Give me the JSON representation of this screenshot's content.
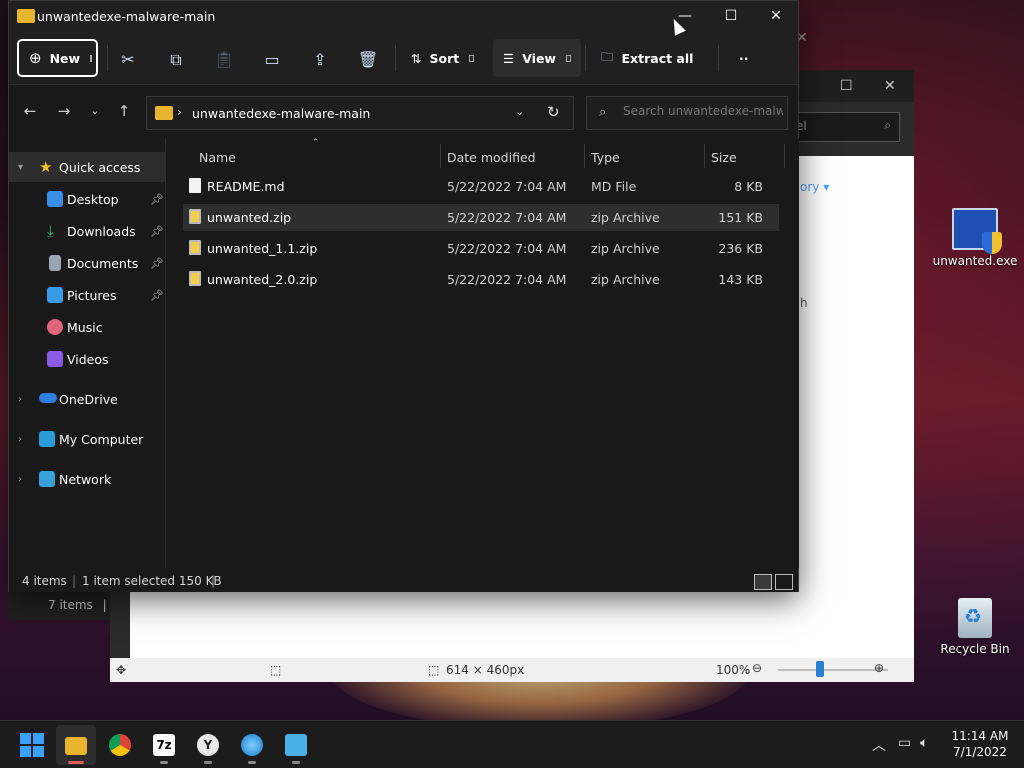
{
  "window": {
    "title": "unwantedexe-malware-main",
    "controls": {
      "minimize": "—",
      "maximize": "☐",
      "close": "✕"
    }
  },
  "toolbar": {
    "new_label": "New",
    "sort_label": "Sort",
    "view_label": "View",
    "extract_label": "Extract all",
    "more_label": "··"
  },
  "address": {
    "path": "unwantedexe-malware-main",
    "search_placeholder": "Search unwantedexe-malwa..."
  },
  "nav": {
    "quick_access": "Quick access",
    "items": [
      {
        "label": "Desktop",
        "icon": "desktop-icon",
        "color": "#3b8ee6",
        "pinned": true
      },
      {
        "label": "Downloads",
        "icon": "downloads-icon",
        "color": "#3fbf7a",
        "pinned": true
      },
      {
        "label": "Documents",
        "icon": "documents-icon",
        "color": "#9aa4b2",
        "pinned": true
      },
      {
        "label": "Pictures",
        "icon": "pictures-icon",
        "color": "#3b9ae6",
        "pinned": true
      },
      {
        "label": "Music",
        "icon": "music-icon",
        "color": "#e0647a",
        "pinned": false
      },
      {
        "label": "Videos",
        "icon": "videos-icon",
        "color": "#8a5ce6",
        "pinned": false
      }
    ],
    "onedrive": "OneDrive",
    "my_computer": "My Computer",
    "network": "Network"
  },
  "columns": {
    "name": "Name",
    "date": "Date modified",
    "type": "Type",
    "size": "Size"
  },
  "files": [
    {
      "name": "README.md",
      "date": "5/22/2022 7:04 AM",
      "type": "MD File",
      "size": "8 KB",
      "kind": "txt",
      "selected": false
    },
    {
      "name": "unwanted.zip",
      "date": "5/22/2022 7:04 AM",
      "type": "zip Archive",
      "size": "151 KB",
      "kind": "zip",
      "selected": true
    },
    {
      "name": "unwanted_1.1.zip",
      "date": "5/22/2022 7:04 AM",
      "type": "zip Archive",
      "size": "236 KB",
      "kind": "zip",
      "selected": false
    },
    {
      "name": "unwanted_2.0.zip",
      "date": "5/22/2022 7:04 AM",
      "type": "zip Archive",
      "size": "143 KB",
      "kind": "zip",
      "selected": false
    }
  ],
  "status": {
    "item_count": "4 items",
    "selection": "1 item selected  150 KB"
  },
  "background_window": {
    "search_placeholder": "anel",
    "link_text": "ory ▾",
    "item_count": "7 items",
    "dimensions": "614 × 460px",
    "zoom": "100%"
  },
  "desktop": {
    "icons": [
      {
        "label": "unwanted.exe"
      },
      {
        "label": "Recycle Bin"
      }
    ]
  },
  "taskbar": {
    "time": "11:14 AM",
    "date": "7/1/2022"
  },
  "colors": {
    "accent": "#3aa0ff",
    "folder": "#e9b52f",
    "selection": "#2e2e2e"
  }
}
